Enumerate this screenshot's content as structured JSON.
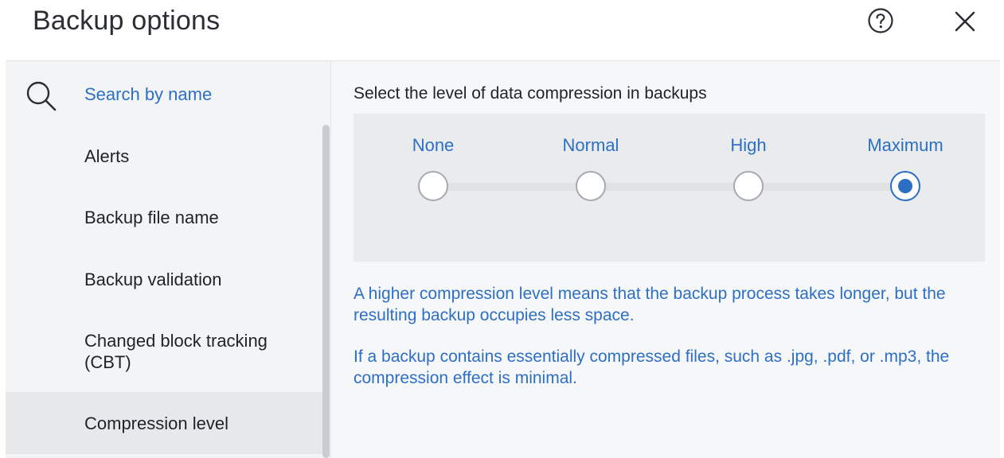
{
  "header": {
    "title": "Backup options",
    "help_icon": "question-circle-icon",
    "close_icon": "close-icon"
  },
  "sidebar": {
    "search_icon": "search-icon",
    "search_placeholder": "Search by name",
    "items": [
      {
        "label": "Alerts",
        "active": false
      },
      {
        "label": "Backup file name",
        "active": false
      },
      {
        "label": "Backup validation",
        "active": false
      },
      {
        "label": "Changed block tracking (CBT)",
        "active": false
      },
      {
        "label": "Compression level",
        "active": true
      }
    ]
  },
  "main": {
    "section_title": "Select the level of data compression in backups",
    "levels": [
      {
        "label": "None",
        "selected": false
      },
      {
        "label": "Normal",
        "selected": false
      },
      {
        "label": "High",
        "selected": false
      },
      {
        "label": "Maximum",
        "selected": true
      }
    ],
    "info_1": "A higher compression level means that the backup process takes longer, but the resulting backup occupies less space.",
    "info_2": "If a backup contains essentially compressed files, such as .jpg, .pdf, or .mp3, the compression effect is minimal."
  },
  "colors": {
    "accent": "#2d6fc4",
    "sidebar_bg": "#f3f4f5",
    "active_item_bg": "#e6e8ea",
    "panel_bg": "#eaebed"
  }
}
